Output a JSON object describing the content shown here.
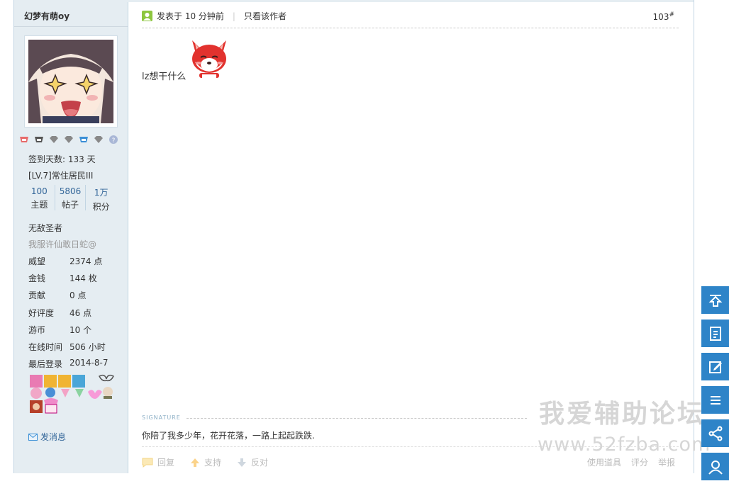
{
  "user": {
    "name": "幻梦有萌oy",
    "checkin": "签到天数: 133 天",
    "level": "[LV.7]常住居民III",
    "counts": [
      {
        "num": "100",
        "label": "主题"
      },
      {
        "num": "5806",
        "label": "帖子"
      },
      {
        "num": "1万",
        "label": "积分"
      }
    ],
    "title": "无敌圣者",
    "motto": "我服许仙敢日蛇@",
    "attrs": [
      {
        "key": "威望",
        "value": "2374 点"
      },
      {
        "key": "金钱",
        "value": "144 枚"
      },
      {
        "key": "贡献",
        "value": "0 点"
      },
      {
        "key": "好评度",
        "value": "46 点"
      },
      {
        "key": "游币",
        "value": "10 个"
      },
      {
        "key": "在线时间",
        "value": "506 小时"
      },
      {
        "key": "最后登录",
        "value": "2014-8-7"
      }
    ],
    "pm_label": "发消息"
  },
  "post": {
    "posted": "发表于 10 分钟前",
    "only_author": "只看该作者",
    "floor": "103",
    "floor_mark": "#",
    "body": "lz想干什么",
    "signature_label": "SIGNATURE",
    "signature": "你陪了我多少年，花开花落，一路上起起跌跌.",
    "actions": {
      "reply": "回复",
      "support": "支持",
      "oppose": "反对",
      "tools": "使用道具",
      "rate": "评分",
      "report": "举报"
    }
  },
  "watermark": {
    "line1": "我爱辅助论坛",
    "line2": "www.52fzba.com"
  },
  "colors": {
    "sidebar_bg": "#e5edf2",
    "link": "#336699",
    "float_btn": "#2e84c8"
  }
}
